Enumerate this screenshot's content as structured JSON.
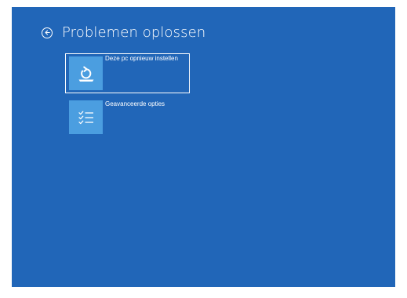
{
  "page": {
    "title": "Problemen oplossen",
    "background_color": "#2166b8",
    "tile_icon_color": "#4b9ee0"
  },
  "back_button": {
    "icon": "back-arrow-circle-icon"
  },
  "options": [
    {
      "label": "Deze pc opnieuw instellen",
      "icon": "reset-pc-icon",
      "selected": true
    },
    {
      "label": "Geavanceerde opties",
      "icon": "checklist-icon",
      "selected": false
    }
  ]
}
